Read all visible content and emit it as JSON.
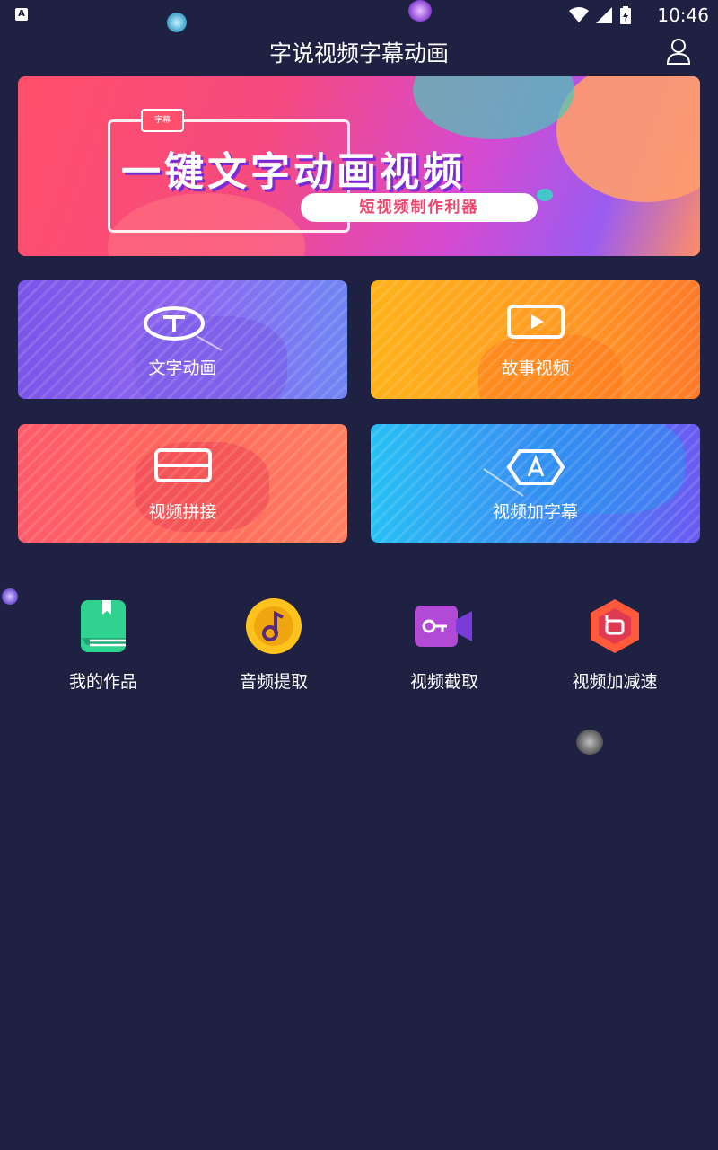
{
  "status_bar": {
    "time": "10:46"
  },
  "header": {
    "title": "字说视频字幕动画"
  },
  "banner": {
    "headline": "一键文字动画视频",
    "tagline": "短视频制作利器",
    "badge": "字幕"
  },
  "features": [
    {
      "label": "文字动画",
      "icon": "text-t-icon"
    },
    {
      "label": "故事视频",
      "icon": "play-icon"
    },
    {
      "label": "视频拼接",
      "icon": "splice-icon"
    },
    {
      "label": "视频加字幕",
      "icon": "hexagon-a-icon"
    }
  ],
  "tools": [
    {
      "label": "我的作品",
      "icon": "book-icon",
      "color": "#2fd28f"
    },
    {
      "label": "音频提取",
      "icon": "music-note-icon",
      "color": "#ffc21d"
    },
    {
      "label": "视频截取",
      "icon": "video-camera-icon",
      "color": "#9b42e8"
    },
    {
      "label": "视频加减速",
      "icon": "speed-hexagon-icon",
      "color": "#ff5a3c"
    }
  ],
  "colors": {
    "background": "#1f2143",
    "accent": "#f0446c"
  }
}
